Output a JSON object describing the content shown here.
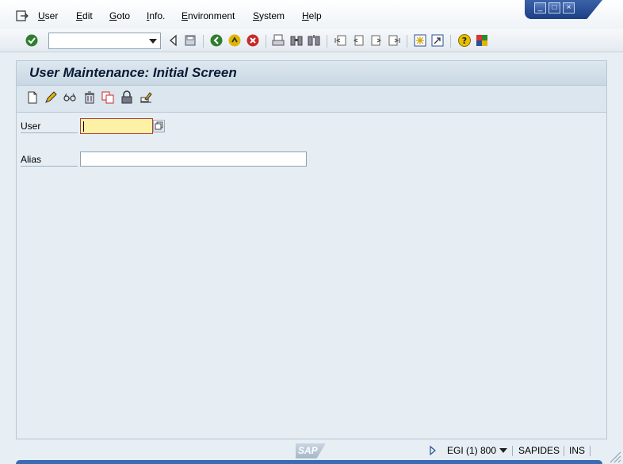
{
  "menu": {
    "items": [
      "User",
      "Edit",
      "Goto",
      "Info.",
      "Environment",
      "System",
      "Help"
    ]
  },
  "window_controls": {
    "minimize": "_",
    "maximize": "□",
    "close": "×"
  },
  "toolbar": {
    "command_field_value": ""
  },
  "screen": {
    "title": "User Maintenance: Initial Screen"
  },
  "form": {
    "user_label": "User",
    "user_value": "",
    "alias_label": "Alias",
    "alias_value": ""
  },
  "status": {
    "logo": "SAP",
    "system": "EGI (1) 800",
    "server": "SAPIDES",
    "mode": "INS"
  },
  "colors": {
    "accent": "#2a4f94",
    "required_field": "#fdf1a6"
  }
}
